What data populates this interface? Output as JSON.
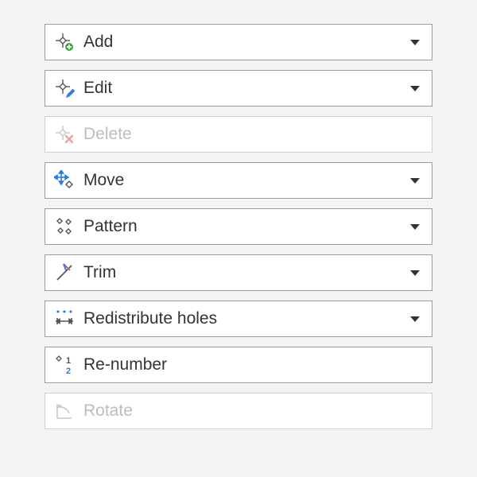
{
  "menu": {
    "items": [
      {
        "label": "Add",
        "enabled": true,
        "dropdown": true
      },
      {
        "label": "Edit",
        "enabled": true,
        "dropdown": true
      },
      {
        "label": "Delete",
        "enabled": false,
        "dropdown": false
      },
      {
        "label": "Move",
        "enabled": true,
        "dropdown": true
      },
      {
        "label": "Pattern",
        "enabled": true,
        "dropdown": true
      },
      {
        "label": "Trim",
        "enabled": true,
        "dropdown": true
      },
      {
        "label": "Redistribute holes",
        "enabled": true,
        "dropdown": true
      },
      {
        "label": "Re-number",
        "enabled": true,
        "dropdown": false
      },
      {
        "label": "Rotate",
        "enabled": false,
        "dropdown": false
      }
    ]
  },
  "colors": {
    "icon_stroke": "#555555",
    "icon_disabled": "#c8c8c8",
    "accent_blue": "#2b7de1",
    "accent_green": "#3ba93b",
    "accent_red": "#e55c5c"
  }
}
